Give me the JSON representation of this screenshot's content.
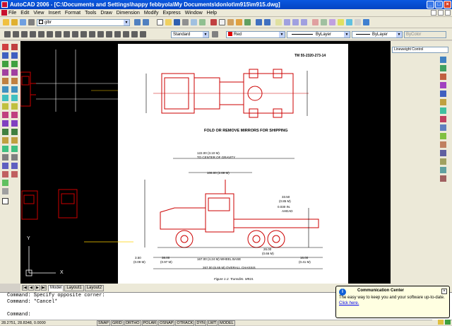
{
  "window": {
    "title": "AutoCAD 2006 - [C:\\Documents and Settings\\happy febbyola\\My Documents\\donlot\\m915\\m915.dwg]",
    "min": "_",
    "max": "□",
    "close": "×"
  },
  "menu": [
    "File",
    "Edit",
    "View",
    "Insert",
    "Format",
    "Tools",
    "Draw",
    "Dimension",
    "Modify",
    "Express",
    "Window",
    "Help"
  ],
  "toolbar1": {
    "layer_value": "glbr"
  },
  "toolbar2": {
    "textstyle": "Standard",
    "color": "Red",
    "linetype": "ByLayer",
    "lineweight": "ByLayer",
    "plotstyle": "ByColor"
  },
  "lineweight_panel": "Lineweight Control",
  "drawing": {
    "doc_id": "TM 55-2320-273-14",
    "caption_top": "FOLD OR REMOVE MIRRORS FOR SHIPPING",
    "dim_122": "122.00  (3.10 M)",
    "dim_122b": "TO CENTER OF GRAVITY",
    "dim_106": "106.00 (2.69 M)",
    "dim_33": "33.50",
    "dim_33b": "(0.85 M)",
    "dim_033": "0.030 IN.",
    "dim_ahead": "AHEAD",
    "dim_26": "26.00",
    "dim_26b": "(0.66 M)",
    "dim_3": "3.50",
    "dim_3b": "(0.09 M)",
    "dim_38": "38.00",
    "dim_38b": "(0.97 M)",
    "dim_167": "167.00  (4.24 M) WHEEL BASE",
    "dim_16": "16.00",
    "dim_16b": "(0.41 M)",
    "dim_267": "267.00  (6.65 M) OVERALL CHASSIS",
    "figure": "Figure 1-2.  Transdim. M915.",
    "ucs_x": "X",
    "ucs_y": "Y"
  },
  "tabs": [
    "Model",
    "Layout1",
    "Layout2"
  ],
  "command": {
    "line1": "Command: Specify opposite corner:",
    "line2": "Command: *Cancel*",
    "line3": "Command:"
  },
  "status": {
    "coords": "28.2751, 28.8348, 0.0000",
    "buttons": [
      "SNAP",
      "GRID",
      "ORTHO",
      "POLAR",
      "OSNAP",
      "OTRACK",
      "DYN",
      "LWT",
      "MODEL"
    ]
  },
  "balloon": {
    "title": "Communication Center",
    "body": "The easy way to keep you and your software up-to-date.",
    "link": "Click here."
  },
  "colors": {
    "titlebar": "#0a58e0",
    "drawing_bg": "#000000",
    "linework": "#cc0000",
    "paper": "#ffffff"
  }
}
